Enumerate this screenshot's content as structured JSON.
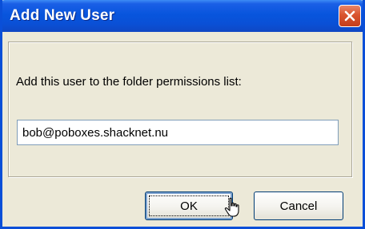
{
  "window": {
    "title": "Add New User"
  },
  "dialog": {
    "prompt": "Add this user to the folder permissions list:",
    "user_value": "bob@poboxes.shacknet.nu"
  },
  "buttons": {
    "ok_label": "OK",
    "cancel_label": "Cancel"
  },
  "icons": {
    "close": "close-icon",
    "cursor": "hand-cursor-icon"
  },
  "colors": {
    "titlebar": "#0855dd",
    "close_button": "#d9542e",
    "dialog_bg": "#ece9d8"
  }
}
